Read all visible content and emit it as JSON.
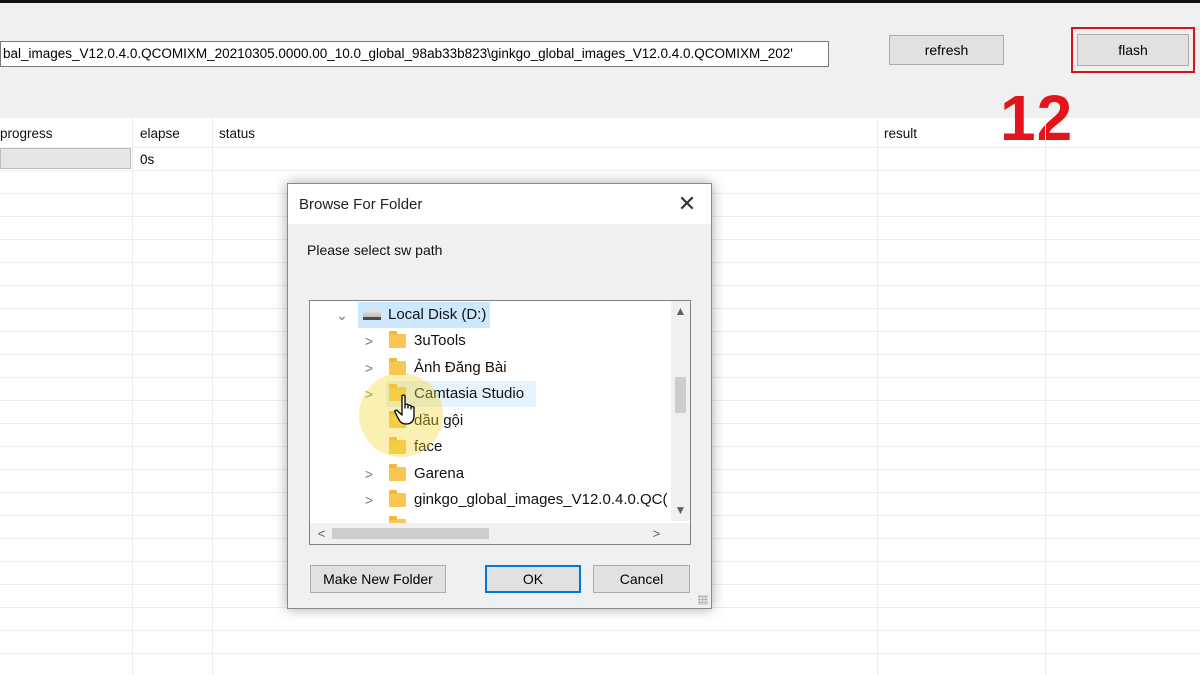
{
  "toolbar": {
    "sw_path_value": "bal_images_V12.0.4.0.QCOMIXM_20210305.0000.00_10.0_global_98ab33b823\\ginkgo_global_images_V12.0.4.0.QCOMIXM_202'",
    "refresh_label": "refresh",
    "flash_label": "flash"
  },
  "annotation": {
    "step_number": "12",
    "color": "#e3141b"
  },
  "grid": {
    "columns": [
      "progress",
      "elapse",
      "status",
      "result"
    ],
    "rows": [
      {
        "progress": "",
        "elapse": "0s",
        "status": "",
        "result": ""
      }
    ]
  },
  "dialog": {
    "title": "Browse For Folder",
    "close_icon": "close-icon",
    "prompt": "Please select sw path",
    "tree": [
      {
        "label": "Local Disk (D:)",
        "icon": "drive-icon",
        "chevron": "chevron-down-icon",
        "selected": true
      },
      {
        "label": "3uTools",
        "icon": "folder-icon",
        "chevron": "chevron-right-icon"
      },
      {
        "label": "Ảnh Đăng Bài",
        "icon": "folder-icon",
        "chevron": "chevron-right-icon"
      },
      {
        "label": "Camtasia Studio",
        "icon": "folder-icon",
        "chevron": "chevron-right-icon",
        "hovered": true
      },
      {
        "label": "dầu gội",
        "icon": "folder-icon",
        "chevron": ""
      },
      {
        "label": "face",
        "icon": "folder-icon",
        "chevron": ""
      },
      {
        "label": "Garena",
        "icon": "folder-icon",
        "chevron": "chevron-right-icon"
      },
      {
        "label": "ginkgo_global_images_V12.0.4.0.QC(",
        "icon": "folder-icon",
        "chevron": "chevron-right-icon"
      }
    ],
    "buttons": {
      "new_folder": "Make New Folder",
      "ok": "OK",
      "cancel": "Cancel"
    }
  },
  "colors": {
    "selection": "#cce8ff",
    "hover": "#e5f3ff",
    "focus_border": "#0078d7",
    "flash_frame": "#d4161c"
  }
}
